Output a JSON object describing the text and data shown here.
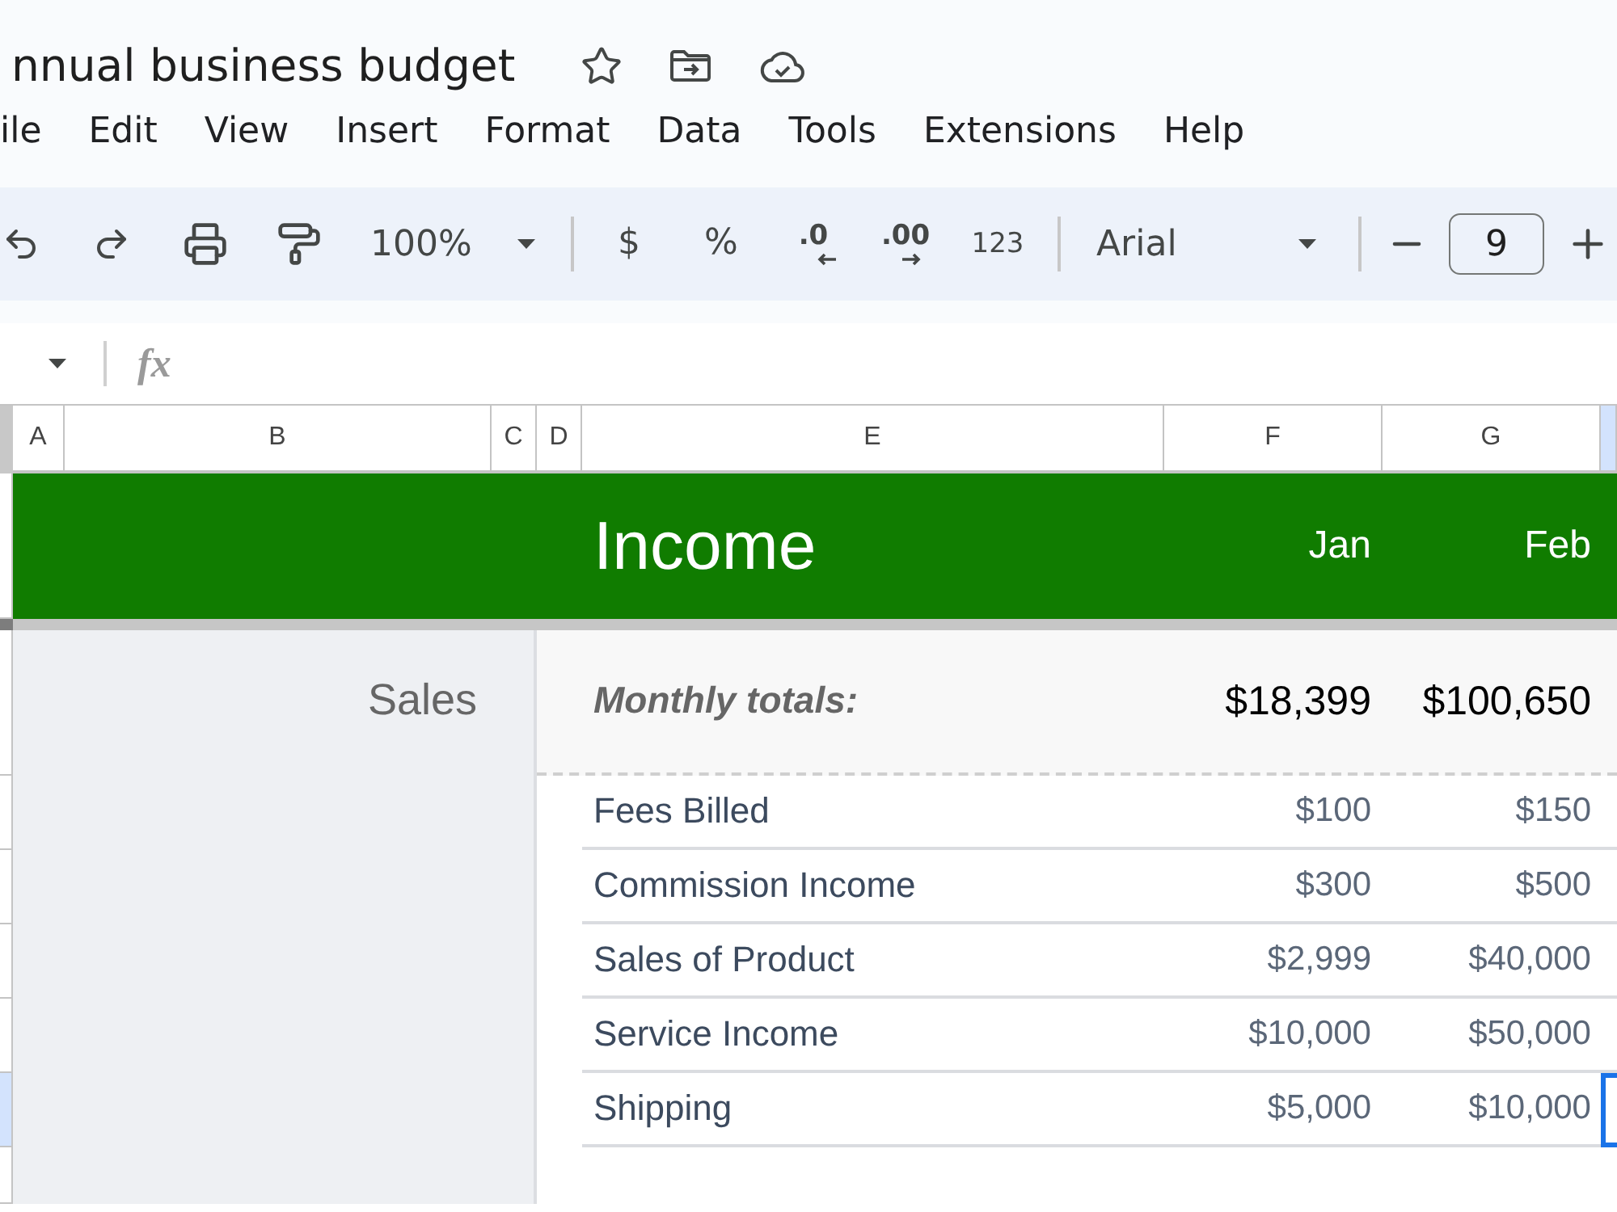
{
  "document": {
    "title": "nnual business budget"
  },
  "menu": [
    "ile",
    "Edit",
    "View",
    "Insert",
    "Format",
    "Data",
    "Tools",
    "Extensions",
    "Help"
  ],
  "toolbar": {
    "zoom": "100%",
    "format_buttons": [
      {
        "kind": "plain",
        "label": "$"
      },
      {
        "kind": "plain",
        "label": "%"
      },
      {
        "kind": "decimal-decrease",
        "label": ".0"
      },
      {
        "kind": "decimal-increase",
        "label": ".00"
      },
      {
        "kind": "small",
        "label": "123"
      }
    ],
    "font": "Arial",
    "font_size": "9"
  },
  "formula_bar": {
    "label": "fx"
  },
  "columns": [
    {
      "label": "A",
      "selected": false
    },
    {
      "label": "B",
      "selected": false
    },
    {
      "label": "C",
      "selected": false
    },
    {
      "label": "D",
      "selected": false
    },
    {
      "label": "E",
      "selected": false
    },
    {
      "label": "F",
      "selected": false
    },
    {
      "label": "G",
      "selected": false
    },
    {
      "selected": true
    }
  ],
  "sheet": {
    "title": "Income",
    "months": [
      "Jan",
      "Feb"
    ],
    "section": "Sales",
    "totals_label": "Monthly totals:",
    "totals": [
      "$18,399",
      "$100,650"
    ],
    "rows": [
      {
        "name": "Fees Billed",
        "values": [
          "$100",
          "$150"
        ],
        "selected": false
      },
      {
        "name": "Commission Income",
        "values": [
          "$300",
          "$500"
        ],
        "selected": false
      },
      {
        "name": "Sales of Product",
        "values": [
          "$2,999",
          "$40,000"
        ],
        "selected": false
      },
      {
        "name": "Service Income",
        "values": [
          "$10,000",
          "$50,000"
        ],
        "selected": false
      },
      {
        "name": "Shipping",
        "values": [
          "$5,000",
          "$10,000"
        ],
        "selected": true
      }
    ]
  }
}
